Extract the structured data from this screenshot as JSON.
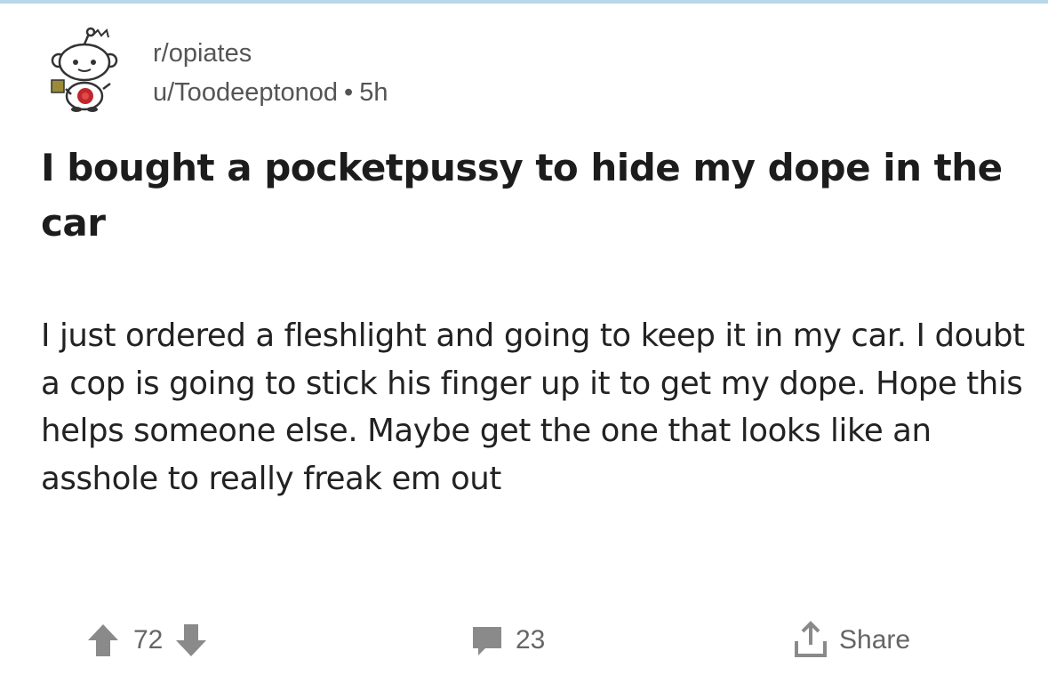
{
  "post": {
    "subreddit": "r/opiates",
    "author": "u/Toodeeptonod",
    "separator": "•",
    "age": "5h",
    "title": "I bought a pocketpussy to hide my dope in the car",
    "body": "I just ordered a fleshlight and going to keep it in my car. I doubt a cop is going to stick his finger up it to get my dope. Hope this helps someone else. Maybe get the one that looks like an asshole to really freak em out"
  },
  "actions": {
    "score": "72",
    "comments": "23",
    "share_label": "Share"
  },
  "icons": {
    "avatar": "snoo-avatar",
    "upvote": "upvote-arrow-icon",
    "downvote": "downvote-arrow-icon",
    "comment": "comment-bubble-icon",
    "share": "share-icon"
  },
  "colors": {
    "top_strip": "#b9d7ea",
    "meta_text": "#555555",
    "icon_gray": "#8a8a8a",
    "avatar_red": "#c0262a"
  }
}
